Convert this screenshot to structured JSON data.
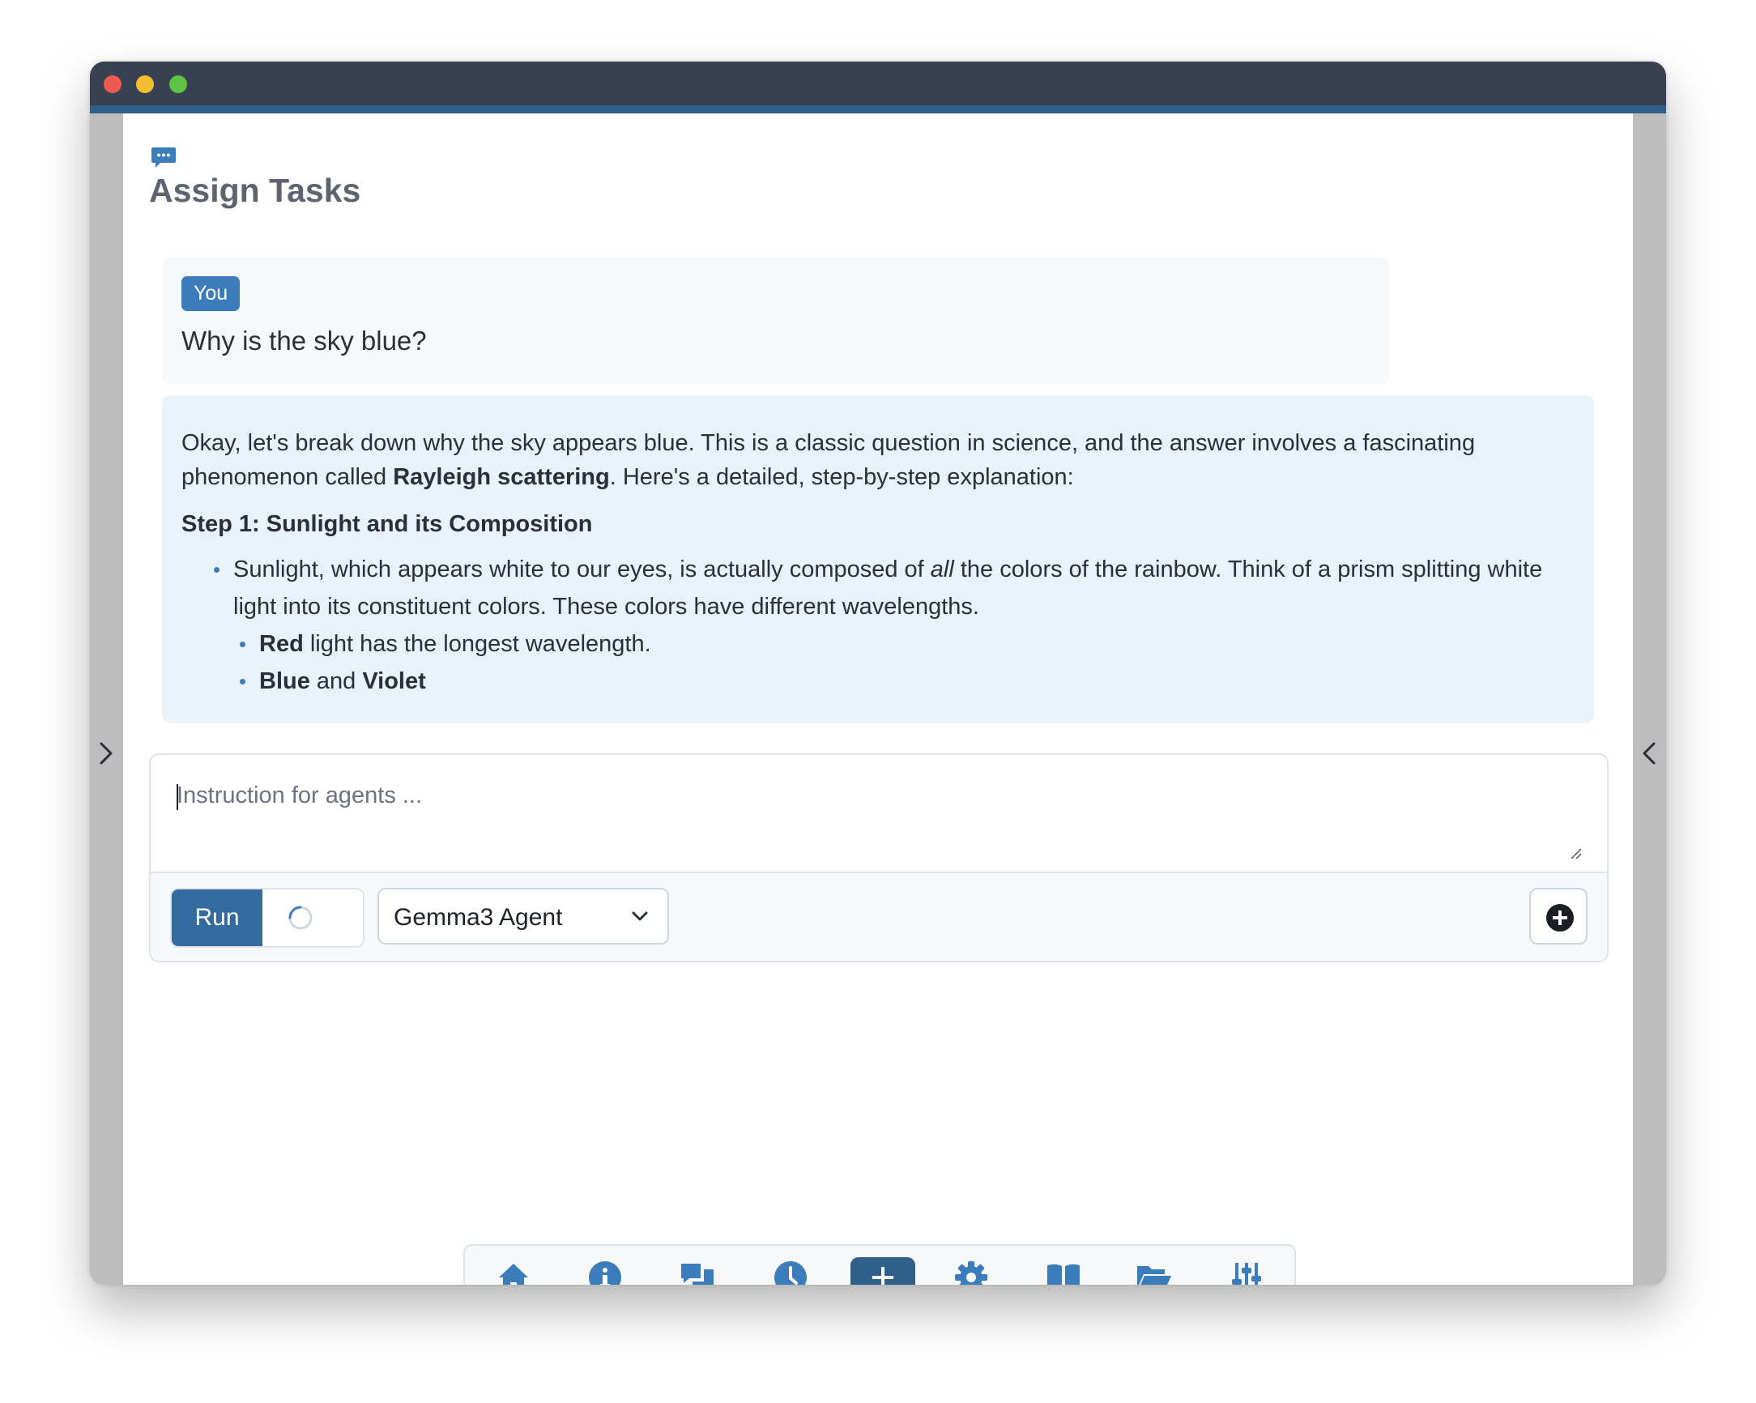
{
  "page": {
    "title": "Assign Tasks"
  },
  "conversation": {
    "user": {
      "badge": "You",
      "text": "Why is the sky blue?"
    },
    "agent": {
      "intro_a": "Okay, let's break down why the sky appears blue. This is a classic question in science, and the answer involves a fascinating phenomenon called ",
      "intro_bold": "Rayleigh scattering",
      "intro_b": ". Here's a detailed, step-by-step explanation:",
      "step_heading": "Step 1: Sunlight and its Composition",
      "bullet_a": "Sunlight, which appears white to our eyes, is actually composed of ",
      "bullet_em": "all",
      "bullet_b": " the colors of the rainbow. Think of a prism splitting white light into its constituent colors. These colors have different wavelengths.",
      "sub1_bold": "Red",
      "sub1_rest": " light has the longest wavelength.",
      "sub2_bold1": "Blue",
      "sub2_mid": " and ",
      "sub2_bold2": "Violet"
    }
  },
  "composer": {
    "placeholder": "Instruction for agents ...",
    "value": "",
    "run_label": "Run",
    "agent_selected": "Gemma3 Agent"
  },
  "nav": {
    "items": [
      "home-icon",
      "info-icon",
      "chat-icon",
      "history-icon",
      "new-task-icon",
      "settings-icon",
      "docs-icon",
      "files-icon",
      "sliders-icon"
    ],
    "active": "new-task-icon"
  },
  "colors": {
    "accent": "#3b7cba",
    "accent_dark": "#2f5f8a",
    "titlebar": "#374151",
    "agent_bubble": "#e9f1f9",
    "user_bubble": "#f6f8fa"
  }
}
